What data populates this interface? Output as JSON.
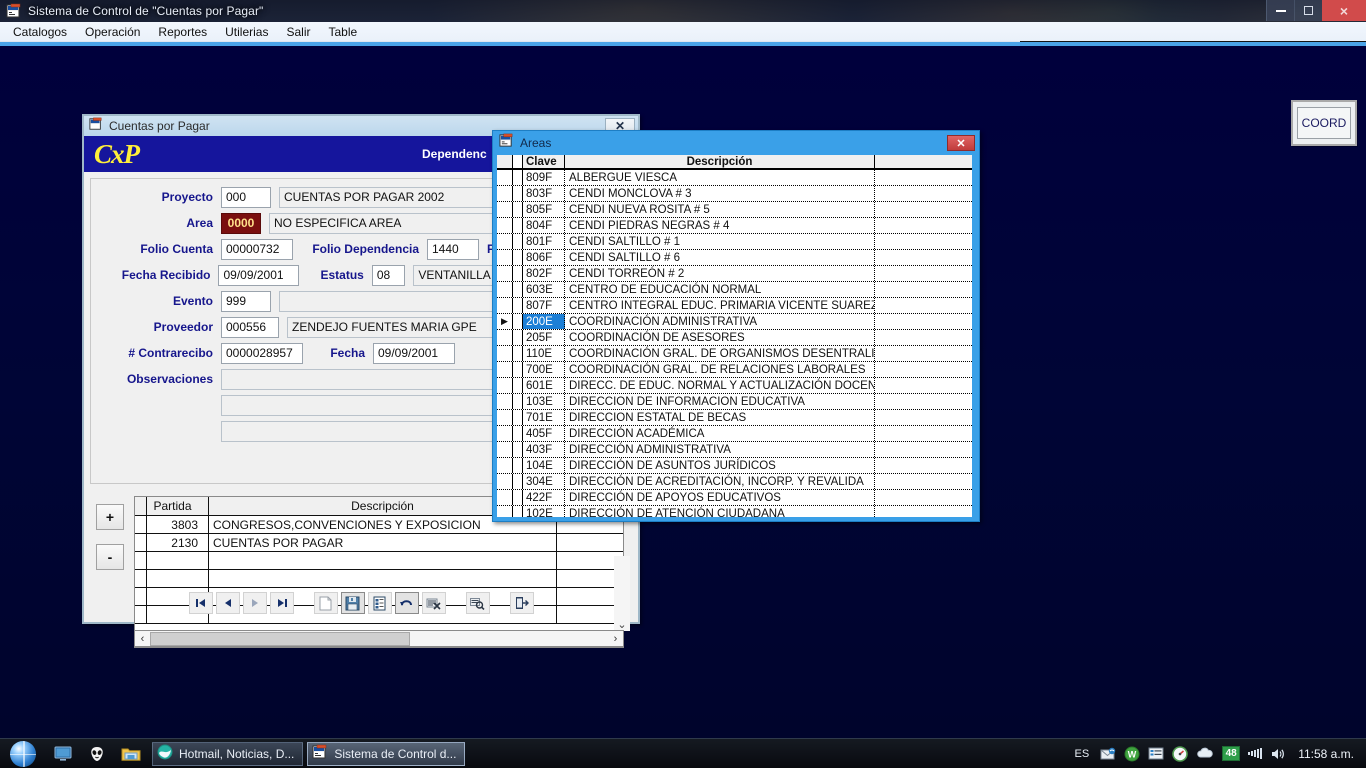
{
  "window": {
    "title": "Sistema de Control de \"Cuentas por Pagar\"",
    "app_icon": "app-icon",
    "minimize_label": "",
    "maximize_label": "",
    "close_label": "×"
  },
  "menubar": {
    "items": [
      "Catalogos",
      "Operación",
      "Reportes",
      "Utilerias",
      "Salir",
      "Table"
    ]
  },
  "coord_window": {
    "label": "COORD"
  },
  "cxp": {
    "title": "Cuentas por Pagar",
    "close_label": "✕",
    "logo": "CxP",
    "banner_right": "Dependenc",
    "fields": {
      "proyecto_label": "Proyecto",
      "proyecto_code": "000",
      "proyecto_desc": "CUENTAS POR PAGAR 2002",
      "area_label": "Area",
      "area_code": "0000",
      "area_desc": "NO ESPECIFICA AREA",
      "folio_cuenta_label": "Folio Cuenta",
      "folio_cuenta_value": "00000732",
      "folio_dependencia_label": "Folio Dependencia",
      "folio_dependencia_value": "1440",
      "fecha_ela_label": "Fecha Ela",
      "fecha_recibido_label": "Fecha Recibido",
      "fecha_recibido_value": "09/09/2001",
      "estatus_label": "Estatus",
      "estatus_code": "08",
      "estatus_desc": "VENTANILLA (PLACIDO",
      "evento_label": "Evento",
      "evento_code": "999",
      "evento_desc": "",
      "proveedor_label": "Proveedor",
      "proveedor_code": "000556",
      "proveedor_desc": "ZENDEJO FUENTES MARIA GPE",
      "contrarecibo_label": "# Contrarecibo",
      "contrarecibo_value": "0000028957",
      "fecha_label": "Fecha",
      "fecha_value": "09/09/2001",
      "observaciones_label": "Observaciones",
      "observaciones_1": "",
      "observaciones_2": "",
      "observaciones_3": ""
    },
    "grid": {
      "add_label": "+",
      "remove_label": "-",
      "columns": [
        "",
        "Partida",
        "Descripción",
        ""
      ],
      "rows": [
        {
          "partida": "3803",
          "descripcion": "CONGRESOS,CONVENCIONES Y EXPOSICION"
        },
        {
          "partida": "2130",
          "descripcion": "CUENTAS POR PAGAR"
        },
        {
          "partida": "",
          "descripcion": ""
        },
        {
          "partida": "",
          "descripcion": ""
        },
        {
          "partida": "",
          "descripcion": ""
        },
        {
          "partida": "",
          "descripcion": ""
        }
      ],
      "scroll_left_label": "‹",
      "scroll_right_label": "›",
      "scroll_down_label": "⌄"
    },
    "toolbar": [
      {
        "name": "first-record-button",
        "glyph": "first"
      },
      {
        "name": "previous-record-button",
        "glyph": "prev"
      },
      {
        "name": "next-record-button",
        "glyph": "next"
      },
      {
        "name": "last-record-button",
        "glyph": "last"
      },
      {
        "name": "new-record-button",
        "glyph": "new"
      },
      {
        "name": "save-record-button",
        "glyph": "save"
      },
      {
        "name": "list-records-button",
        "glyph": "list"
      },
      {
        "name": "undo-button",
        "glyph": "undo"
      },
      {
        "name": "delete-record-button",
        "glyph": "delete"
      },
      {
        "name": "find-record-button",
        "glyph": "find"
      },
      {
        "name": "exit-button",
        "glyph": "exit"
      }
    ]
  },
  "areas_dialog": {
    "title": "Areas",
    "close_label": "✕",
    "columns": [
      "",
      "",
      "Clave",
      "Descripción",
      ""
    ],
    "selected_row_index": 9,
    "row_marker": "▶",
    "rows": [
      {
        "clave": "809F",
        "descripcion": "ALBERGUE VIESCA"
      },
      {
        "clave": "803F",
        "descripcion": "CENDI MONCLOVA # 3"
      },
      {
        "clave": "805F",
        "descripcion": "CENDI NUEVA ROSITA # 5"
      },
      {
        "clave": "804F",
        "descripcion": "CENDI PIEDRAS NEGRAS # 4"
      },
      {
        "clave": "801F",
        "descripcion": "CENDI SALTILLO # 1"
      },
      {
        "clave": "806F",
        "descripcion": "CENDI SALTILLO # 6"
      },
      {
        "clave": "802F",
        "descripcion": "CENDI TORREÓN # 2"
      },
      {
        "clave": "603E",
        "descripcion": "CENTRO DE EDUCACIÓN NORMAL"
      },
      {
        "clave": "807F",
        "descripcion": "CENTRO INTEGRAL EDUC. PRIMARIA VICENTE SUAREZ"
      },
      {
        "clave": "200E",
        "descripcion": "COORDINACIÓN ADMINISTRATIVA"
      },
      {
        "clave": "205F",
        "descripcion": "COORDINACIÓN DE ASESORES"
      },
      {
        "clave": "110E",
        "descripcion": "COORDINACIÓN GRAL. DE ORGANISMOS DESENTRALIZA"
      },
      {
        "clave": "700E",
        "descripcion": "COORDINACIÓN GRAL. DE RELACIONES LABORALES"
      },
      {
        "clave": "601E",
        "descripcion": "DIRECC. DE EDUC. NORMAL Y ACTUALIZACIÓN DOCEN"
      },
      {
        "clave": "103E",
        "descripcion": "DIRECCION DE INFORMACION EDUCATIVA"
      },
      {
        "clave": "701E",
        "descripcion": "DIRECCION ESTATAL DE BECAS"
      },
      {
        "clave": "405F",
        "descripcion": "DIRECCIÓN ACADÉMICA"
      },
      {
        "clave": "403F",
        "descripcion": "DIRECCIÓN ADMINISTRATIVA"
      },
      {
        "clave": "104E",
        "descripcion": "DIRECCIÓN DE  ASUNTOS JURÍDICOS"
      },
      {
        "clave": "304E",
        "descripcion": "DIRECCIÓN DE ACREDITACIÓN, INCORP. Y REVALIDA"
      },
      {
        "clave": "422F",
        "descripcion": "DIRECCIÓN DE APOYOS EDUCATIVOS"
      },
      {
        "clave": "102E",
        "descripcion": "DIRECCIÓN DE ATENCIÓN CIUDADANA"
      }
    ]
  },
  "taskbar": {
    "start_label": "",
    "quicklaunch": [
      "show-desktop-icon",
      "alien-icon",
      "explorer-icon"
    ],
    "tasks": [
      {
        "label": "Hotmail, Noticias, D...",
        "icon": "browser-icon",
        "active": false
      },
      {
        "label": "Sistema de Control d...",
        "icon": "app-icon",
        "active": true
      }
    ],
    "tray": {
      "language": "ES",
      "icons": [
        "mail-icon",
        "w-icon",
        "list-icon",
        "speedometer-icon",
        "cloud-icon"
      ],
      "badge": "48",
      "network": "signal-icon",
      "volume": "speaker-icon"
    },
    "clock": "11:58 a.m."
  },
  "colors": {
    "accent_blue": "#15159c",
    "dialog_blue": "#3aa0e8",
    "selection_blue": "#1c7fd6",
    "area_red": "#7a0f0f",
    "logo_yellow": "#ffef3a"
  }
}
